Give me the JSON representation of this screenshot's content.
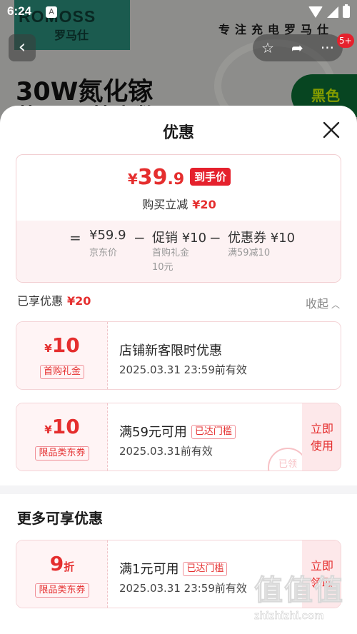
{
  "status_bar": {
    "time": "6:24",
    "notification_icon": "A"
  },
  "background": {
    "brand_name": "ROMOSS",
    "brand_cn": "罗马仕",
    "slogan": "专注充电罗马仕",
    "headline": "30W氮化镓",
    "headline2": "苹果PD快充数",
    "badge": "黑色",
    "message_count": "5+"
  },
  "sheet": {
    "title": "优惠",
    "price_summary": {
      "currency": "¥",
      "price_int": "39",
      "price_dec": ".9",
      "final_label": "到手价",
      "discount_label": "购买立减",
      "discount_amount": "¥20",
      "formula": {
        "equals": "=",
        "base_price": "¥59.9",
        "base_label": "京东价",
        "minus1": "−",
        "promo": "促销 ¥10",
        "promo_note_line1": "首购礼金",
        "promo_note_line2": "10元",
        "minus2": "−",
        "coupon": "优惠券 ¥10",
        "coupon_note": "满59减10"
      }
    },
    "enjoyed": {
      "label": "已享优惠",
      "amount": "¥20",
      "collapse_label": "收起"
    },
    "coupons": [
      {
        "currency": "¥",
        "value": "10",
        "kind": "首购礼金",
        "title": "店铺新客限时优惠",
        "met_tag": "",
        "valid": "2025.03.31 23:59前有效",
        "action": ""
      },
      {
        "currency": "¥",
        "value": "10",
        "kind": "限品类东券",
        "title": "满59元可用",
        "met_tag": "已达门槛",
        "valid": "2025.03.31前有效",
        "action_line1": "立即",
        "action_line2": "使用",
        "stamp": "已领"
      }
    ],
    "more_title": "更多可享优惠",
    "more_coupons": [
      {
        "value": "9",
        "unit": "折",
        "kind": "限品类东券",
        "title": "满1元可用",
        "met_tag": "已达门槛",
        "valid": "2025.03.31 23:59前有效",
        "action_line1": "立即",
        "action_line2": "领取"
      }
    ]
  },
  "watermark": {
    "glyphs": "值值值",
    "url": "zhizhizhi.com"
  },
  "colors": {
    "accent": "#e52e2e",
    "tag_bg": "#e5212d",
    "coupon_bg": "#fff4f5"
  }
}
